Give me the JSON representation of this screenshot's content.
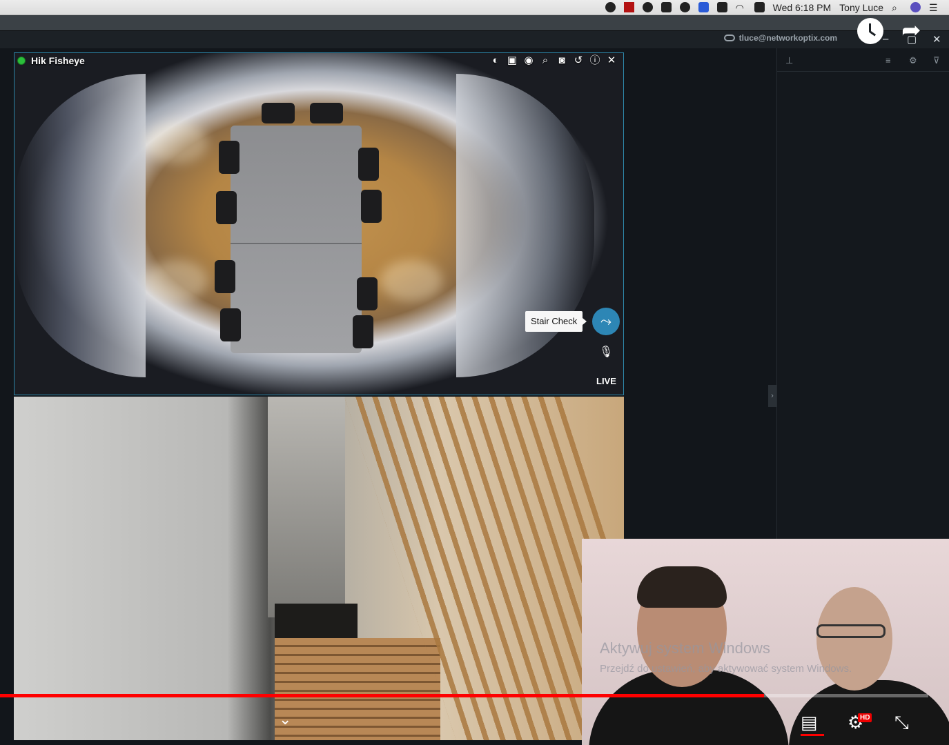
{
  "menubar": {
    "clock": "Wed 6:18 PM",
    "user": "Tony Luce",
    "icons": [
      "notification-icon",
      "app-icon",
      "skype-icon",
      "vpn-icon",
      "camera-icon",
      "remote-icon",
      "battery-icon",
      "wifi-icon",
      "battery-charging-icon",
      "search-icon",
      "siri-icon",
      "menu-list-icon"
    ]
  },
  "app": {
    "account": "tluce@networkoptix.com",
    "window_controls": [
      "–",
      "▢",
      "✕"
    ]
  },
  "camera1": {
    "title": "Hik Fisheye",
    "status_color": "#2bbf3b",
    "tools": [
      "◐",
      "▣",
      "◉",
      "⌕",
      "◙",
      "↺",
      "ⓘ",
      "✕"
    ],
    "tooltip": "Stair Check",
    "live_label": "LIVE"
  },
  "webcam_watermark": {
    "line1": "Aktywuj system Windows",
    "line2": "Przejdź do ustawień, aby aktywować system Windows."
  },
  "player": {
    "progress": 0.823,
    "hd_badge": "HD",
    "chevron": "⌄"
  },
  "colors": {
    "accent": "#2d86b5",
    "progress_red": "#ff0000",
    "tile_border": "#2d86a8"
  }
}
